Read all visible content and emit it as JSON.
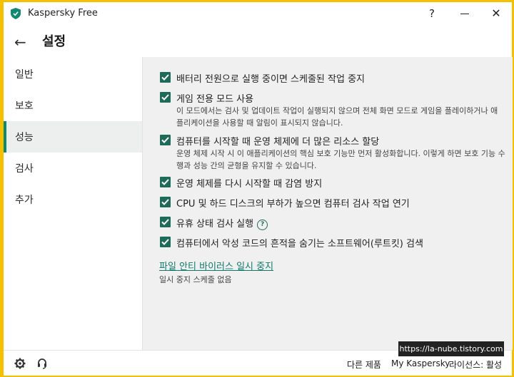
{
  "app": {
    "title": "Kaspersky Free",
    "icon": "kaspersky-shield-icon",
    "accent": "#0e8a6e"
  },
  "titlebar": {
    "help": "?",
    "close": "✕"
  },
  "header": {
    "back": "←",
    "title": "설정"
  },
  "sidebar": {
    "items": [
      {
        "label": "일반",
        "active": false
      },
      {
        "label": "보호",
        "active": false
      },
      {
        "label": "성능",
        "active": true
      },
      {
        "label": "검사",
        "active": false
      },
      {
        "label": "추가",
        "active": false
      }
    ]
  },
  "options": [
    {
      "label": "배터리 전원으로 실행 중이면 스케줄된 작업 중지",
      "checked": true
    },
    {
      "label": "게임 전용 모드 사용",
      "checked": true,
      "desc": "이 모드에서는 검사 및 업데이트 작업이 실행되지 않으며 전체 화면 모드로 게임을 플레이하거나 애플리케이션을 사용할 때 알림이 표시되지 않습니다."
    },
    {
      "label": "컴퓨터를 시작할 때 운영 체제에 더 많은 리소스 할당",
      "checked": true,
      "desc": "운영 체제 시작 시 이 애플리케이션의 핵심 보호 기능만 먼저 활성화합니다. 이렇게 하면 보호 기능 수행과 성능 간의 균형을 유지할 수 있습니다."
    },
    {
      "label": "운영 체제를 다시 시작할 때 감염 방지",
      "checked": true
    },
    {
      "label": "CPU 및 하드 디스크의 부하가 높으면 컴퓨터 검사 작업 연기",
      "checked": true
    },
    {
      "label": "유휴 상태 검사 실행",
      "checked": true,
      "help": "?"
    },
    {
      "label": "컴퓨터에서 악성 코드의 흔적을 숨기는 소프트웨어(루트킷) 검색",
      "checked": true
    }
  ],
  "pause": {
    "link": "파일 안티 바이러스 일시 중지",
    "status": "일시 중지 스케줄 없음"
  },
  "footer": {
    "settings_icon": "gear-icon",
    "support_icon": "support-icon",
    "links": [
      "다른 제품",
      "My Kaspersky",
      "라이선스: 활성"
    ]
  },
  "watermark": "https://la-nube.tistory.com"
}
